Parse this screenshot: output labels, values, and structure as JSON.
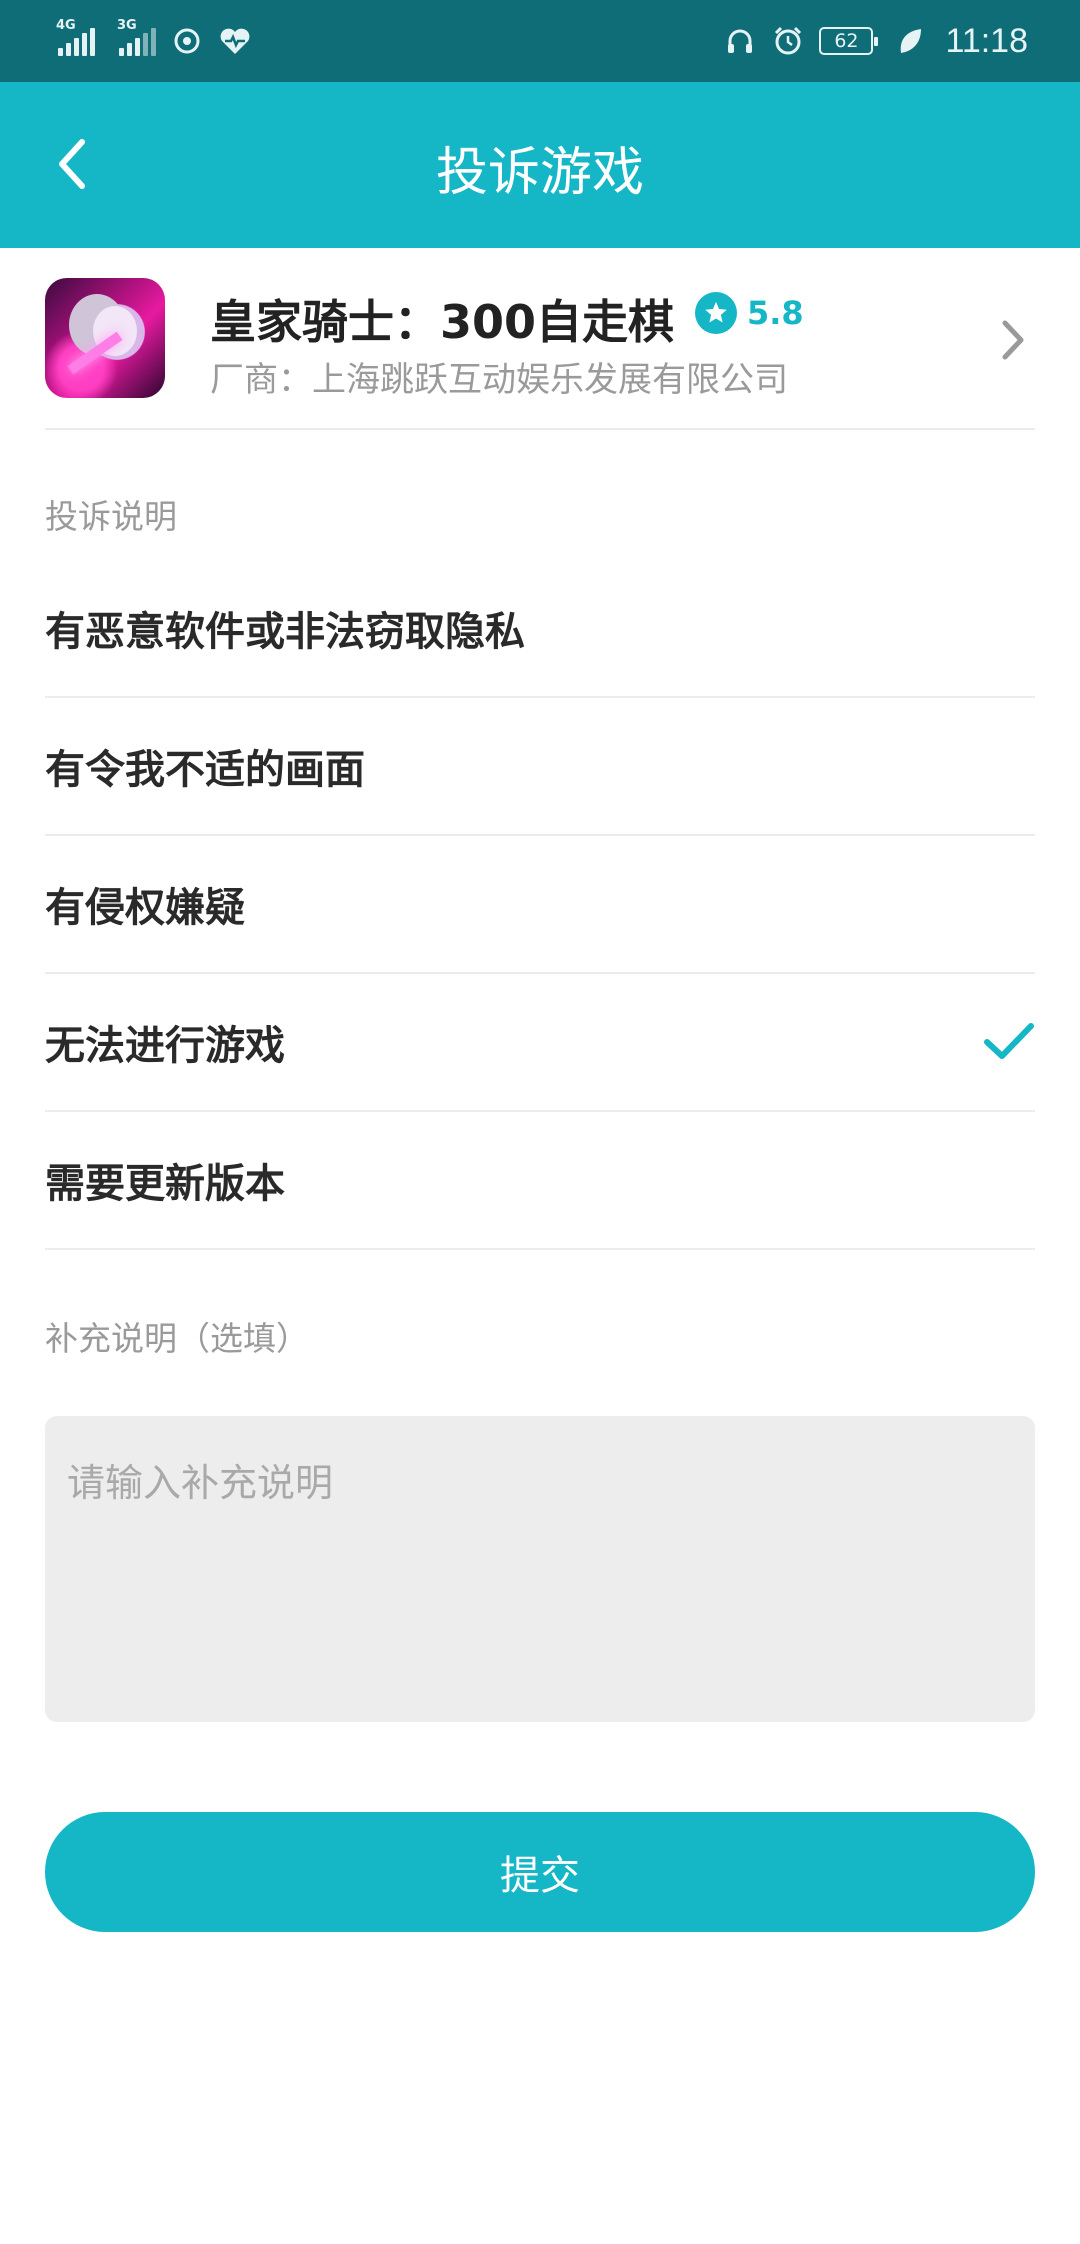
{
  "status_bar": {
    "signal1_label": "4G",
    "signal2_label": "3G",
    "battery": "62",
    "time": "11:18"
  },
  "header": {
    "title": "投诉游戏",
    "back_icon": "chevron-left-icon"
  },
  "game": {
    "name": "皇家骑士：300自走棋",
    "rating": "5.8",
    "vendor": "厂商：上海跳跃互动娱乐发展有限公司"
  },
  "complaint": {
    "section_label": "投诉说明",
    "reasons": [
      {
        "label": "有恶意软件或非法窃取隐私",
        "selected": false
      },
      {
        "label": "有令我不适的画面",
        "selected": false
      },
      {
        "label": "有侵权嫌疑",
        "selected": false
      },
      {
        "label": "无法进行游戏",
        "selected": true
      },
      {
        "label": "需要更新版本",
        "selected": false
      }
    ]
  },
  "supplement": {
    "section_label": "补充说明（选填）",
    "placeholder": "请输入补充说明",
    "value": ""
  },
  "submit": {
    "label": "提交"
  },
  "colors": {
    "accent": "#15b7c7",
    "status_bar": "#0f6d78"
  }
}
